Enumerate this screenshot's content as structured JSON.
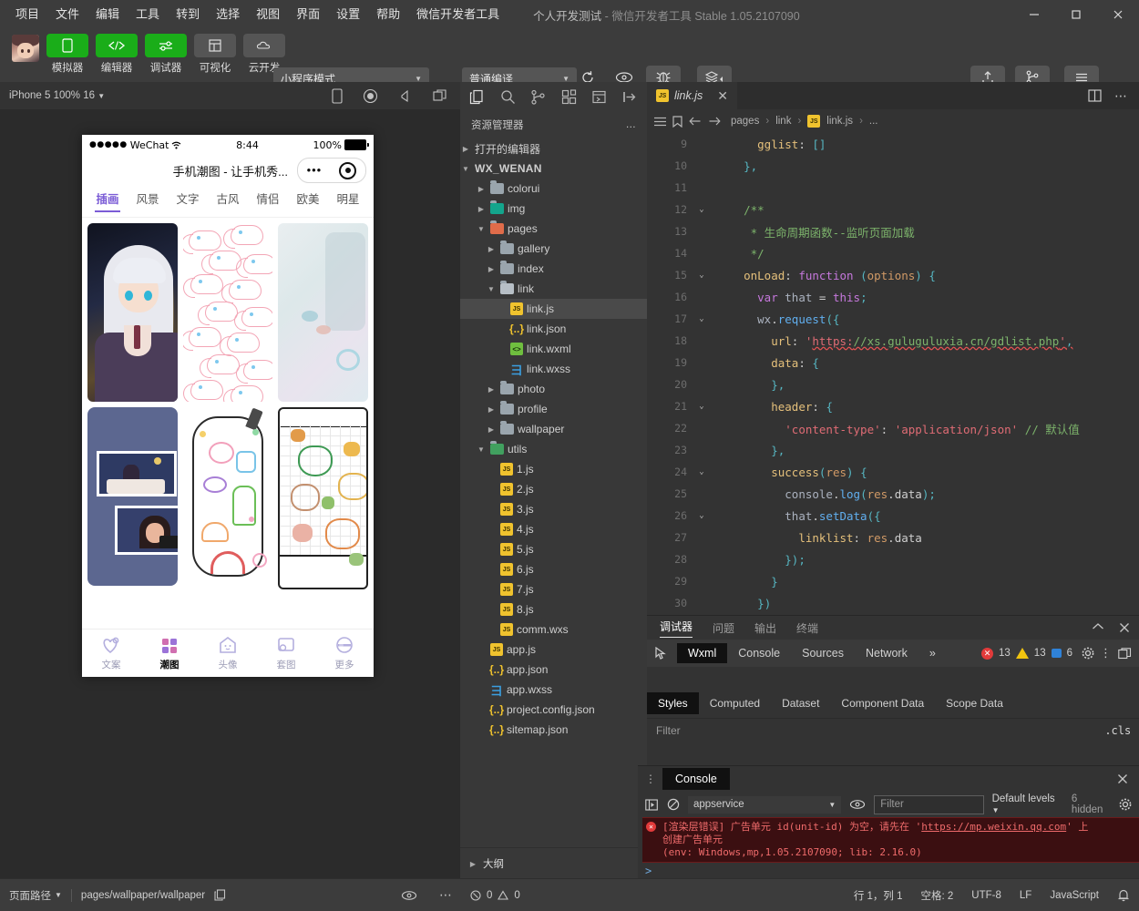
{
  "titlebar": {
    "menus": [
      "项目",
      "文件",
      "编辑",
      "工具",
      "转到",
      "选择",
      "视图",
      "界面",
      "设置",
      "帮助",
      "微信开发者工具"
    ],
    "project_name": "个人开发测试",
    "dash": "-",
    "app_name": "微信开发者工具",
    "version": "Stable 1.05.2107090",
    "minimize": "—",
    "maximize": "□",
    "close": "✕"
  },
  "toolbar": {
    "left_items": [
      {
        "label": "模拟器",
        "icon": "phone-icon",
        "style": "green"
      },
      {
        "label": "编辑器",
        "icon": "code-icon",
        "style": "green"
      },
      {
        "label": "调试器",
        "icon": "debug-slider-icon",
        "style": "green"
      },
      {
        "label": "可视化",
        "icon": "layout-icon",
        "style": "gray"
      },
      {
        "label": "云开发",
        "icon": "cloud-icon",
        "style": "gray"
      }
    ],
    "mode_select": "小程序模式",
    "compile_select": "普通编译",
    "compile_label": "编译",
    "preview_label": "预览",
    "realdevice_label": "真机调试",
    "clearcache_label": "清缓存",
    "upload_label": "上传",
    "version_label": "版本管理",
    "details_label": "详情"
  },
  "simulator": {
    "device": "iPhone 5 100% 16",
    "icons": [
      "phone-rotate-icon",
      "record-icon",
      "volume-icon",
      "window-icon"
    ]
  },
  "phone": {
    "carrier": "WeChat",
    "dots": "●●●●●",
    "wifi": "≋",
    "time": "8:44",
    "battery_pct": "100%",
    "nav_title": "手机潮图 - 让手机秀...",
    "tabs": [
      "插画",
      "风景",
      "文字",
      "古风",
      "情侣",
      "欧美",
      "明星"
    ],
    "active_tab": "插画",
    "bottom_tabs": [
      {
        "label": "文案",
        "icon": "hearts-icon",
        "active": false
      },
      {
        "label": "潮图",
        "icon": "grid-icon",
        "active": true
      },
      {
        "label": "头像",
        "icon": "ghost-icon",
        "active": false
      },
      {
        "label": "套图",
        "icon": "album-icon",
        "active": false
      },
      {
        "label": "更多",
        "icon": "more-face-icon",
        "active": false
      }
    ]
  },
  "explorer": {
    "activity_icons": [
      "files-icon",
      "search-icon",
      "source-control-icon",
      "extensions-icon",
      "debug-icon",
      "collapse-icon"
    ],
    "title": "资源管理器",
    "more": "…",
    "open_editors": "打开的编辑器",
    "root": "WX_WENAN",
    "tree": [
      {
        "name": "colorui",
        "depth": 1,
        "kind": "folder",
        "state": "collapsed"
      },
      {
        "name": "img",
        "depth": 1,
        "kind": "folder-teal",
        "state": "collapsed"
      },
      {
        "name": "pages",
        "depth": 1,
        "kind": "folder-red",
        "state": "expanded"
      },
      {
        "name": "gallery",
        "depth": 2,
        "kind": "folder",
        "state": "collapsed"
      },
      {
        "name": "index",
        "depth": 2,
        "kind": "folder",
        "state": "collapsed"
      },
      {
        "name": "link",
        "depth": 2,
        "kind": "folder-open",
        "state": "expanded"
      },
      {
        "name": "link.js",
        "depth": 3,
        "kind": "js",
        "state": "selected"
      },
      {
        "name": "link.json",
        "depth": 3,
        "kind": "json",
        "state": "none"
      },
      {
        "name": "link.wxml",
        "depth": 3,
        "kind": "wxml",
        "state": "none"
      },
      {
        "name": "link.wxss",
        "depth": 3,
        "kind": "wxss",
        "state": "none"
      },
      {
        "name": "photo",
        "depth": 2,
        "kind": "folder",
        "state": "collapsed"
      },
      {
        "name": "profile",
        "depth": 2,
        "kind": "folder",
        "state": "collapsed"
      },
      {
        "name": "wallpaper",
        "depth": 2,
        "kind": "folder",
        "state": "collapsed"
      },
      {
        "name": "utils",
        "depth": 1,
        "kind": "folder-green",
        "state": "expanded"
      },
      {
        "name": "1.js",
        "depth": 2,
        "kind": "js",
        "state": "none"
      },
      {
        "name": "2.js",
        "depth": 2,
        "kind": "js",
        "state": "none"
      },
      {
        "name": "3.js",
        "depth": 2,
        "kind": "js",
        "state": "none"
      },
      {
        "name": "4.js",
        "depth": 2,
        "kind": "js",
        "state": "none"
      },
      {
        "name": "5.js",
        "depth": 2,
        "kind": "js",
        "state": "none"
      },
      {
        "name": "6.js",
        "depth": 2,
        "kind": "js",
        "state": "none"
      },
      {
        "name": "7.js",
        "depth": 2,
        "kind": "js",
        "state": "none"
      },
      {
        "name": "8.js",
        "depth": 2,
        "kind": "js",
        "state": "none"
      },
      {
        "name": "comm.wxs",
        "depth": 2,
        "kind": "js",
        "state": "none"
      },
      {
        "name": "app.js",
        "depth": 1,
        "kind": "js",
        "state": "none"
      },
      {
        "name": "app.json",
        "depth": 1,
        "kind": "json",
        "state": "none"
      },
      {
        "name": "app.wxss",
        "depth": 1,
        "kind": "wxss",
        "state": "none"
      },
      {
        "name": "project.config.json",
        "depth": 1,
        "kind": "json",
        "state": "none"
      },
      {
        "name": "sitemap.json",
        "depth": 1,
        "kind": "json",
        "state": "none"
      }
    ],
    "outline": "大纲"
  },
  "editor": {
    "tab_name": "link.js",
    "tab_close": "✕",
    "split_icon": "split-editor-icon",
    "more_icon": "more-icon",
    "breadcrumb": [
      "pages",
      "link",
      "link.js",
      "..."
    ],
    "lines": [
      {
        "num": "9",
        "fold": "",
        "text": "      gglist: []",
        "type": "code"
      },
      {
        "num": "10",
        "fold": "",
        "text": "    },",
        "type": "code"
      },
      {
        "num": "11",
        "fold": "",
        "text": "",
        "type": "code"
      },
      {
        "num": "12",
        "fold": "v",
        "text": "    /**",
        "type": "comment"
      },
      {
        "num": "13",
        "fold": "",
        "text": "     * 生命周期函数--监听页面加载",
        "type": "comment"
      },
      {
        "num": "14",
        "fold": "",
        "text": "     */",
        "type": "comment"
      },
      {
        "num": "15",
        "fold": "v",
        "text": "    onLoad: function (options) {",
        "type": "code"
      },
      {
        "num": "16",
        "fold": "",
        "text": "      var that = this;",
        "type": "code"
      },
      {
        "num": "17",
        "fold": "v",
        "text": "      wx.request({",
        "type": "code"
      },
      {
        "num": "18",
        "fold": "",
        "text": "        url: 'https://xs.guluguluxia.cn/gdlist.php',",
        "type": "code"
      },
      {
        "num": "19",
        "fold": "",
        "text": "        data: {",
        "type": "code"
      },
      {
        "num": "20",
        "fold": "",
        "text": "        },",
        "type": "code"
      },
      {
        "num": "21",
        "fold": "v",
        "text": "        header: {",
        "type": "code"
      },
      {
        "num": "22",
        "fold": "",
        "text": "          'content-type': 'application/json' // 默认值",
        "type": "code"
      },
      {
        "num": "23",
        "fold": "",
        "text": "        },",
        "type": "code"
      },
      {
        "num": "24",
        "fold": "v",
        "text": "        success(res) {",
        "type": "code"
      },
      {
        "num": "25",
        "fold": "",
        "text": "          console.log(res.data);",
        "type": "code"
      },
      {
        "num": "26",
        "fold": "v",
        "text": "          that.setData({",
        "type": "code"
      },
      {
        "num": "27",
        "fold": "",
        "text": "            linklist: res.data",
        "type": "code"
      },
      {
        "num": "28",
        "fold": "",
        "text": "          });",
        "type": "code"
      },
      {
        "num": "29",
        "fold": "",
        "text": "        }",
        "type": "code"
      },
      {
        "num": "30",
        "fold": "",
        "text": "      })",
        "type": "code"
      }
    ]
  },
  "debugger": {
    "panel_tabs": [
      "调试器",
      "问题",
      "输出",
      "终端"
    ],
    "panel_active": "调试器",
    "collapse_icon": "chevron-up-icon",
    "close_icon": "close-icon",
    "devtool_tabs": [
      "Wxml",
      "Console",
      "Sources",
      "Network"
    ],
    "devtool_active": "Wxml",
    "overflow": "»",
    "inspect_icon": "inspect-icon",
    "errors": "13",
    "warnings": "13",
    "infos": "6",
    "gear_icon": "gear-icon",
    "kebab_icon": "kebab-icon",
    "dock_icon": "dock-icon",
    "style_tabs": [
      "Styles",
      "Computed",
      "Dataset",
      "Component Data",
      "Scope Data"
    ],
    "style_active": "Styles",
    "filter_placeholder": "Filter",
    "cls": ".cls",
    "plus": "+"
  },
  "console": {
    "title": "Console",
    "close": "✕",
    "drag_icon": "drag-handle-icon",
    "execute_icon": "execute-context-icon",
    "clear_icon": "clear-console-icon",
    "context": "appservice",
    "eye_icon": "eye-icon",
    "filter_placeholder": "Filter",
    "levels": "Default levels",
    "hidden": "6 hidden",
    "settings_icon": "gear-icon",
    "error_line1": "[渲染层错误] 广告单元 id(unit-id) 为空，请先在 'https://mp.weixin.qq.com' 上",
    "error_line2": "创建广告单元",
    "error_line3": "(env: Windows,mp,1.05.2107090; lib: 2.16.0)",
    "error_link": "https://mp.weixin.qq.com",
    "prompt": ">"
  },
  "statusbar": {
    "page_path_label": "页面路径",
    "page_path": "pages/wallpaper/wallpaper",
    "copy_icon": "copy-icon",
    "eye_icon": "eye-icon",
    "more_icon": "more-icon",
    "problems_errors": "0",
    "problems_warnings": "0",
    "cursor": "行 1，列 1",
    "spaces": "空格: 2",
    "encoding": "UTF-8",
    "eol": "LF",
    "language": "JavaScript",
    "bell_icon": "bell-icon"
  },
  "colors": {
    "accent_green": "#1aad19",
    "title_bg": "#3c3c3c",
    "panel_bg": "#333333",
    "explorer_bg": "#383838",
    "error_red": "#e23b3b",
    "phone_accent": "#7b5cd6"
  }
}
